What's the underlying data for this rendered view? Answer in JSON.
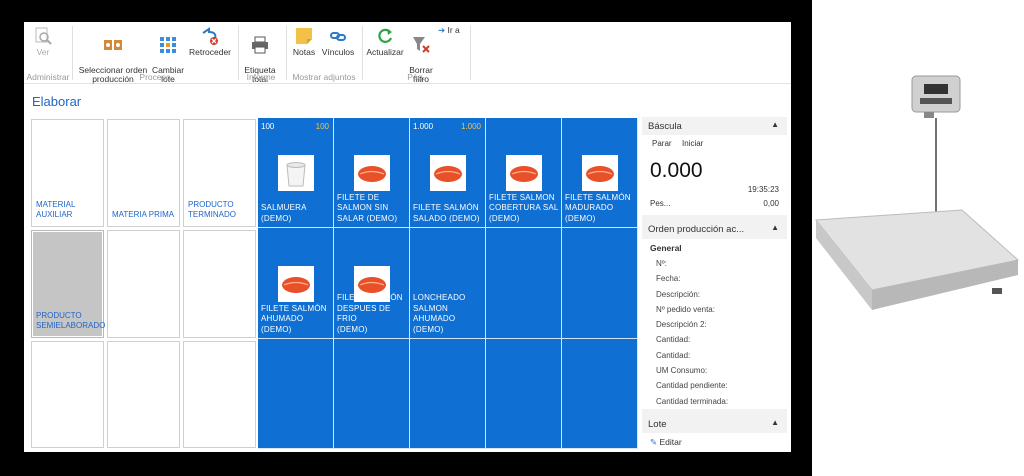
{
  "ribbon": {
    "ver": "Ver",
    "seleccionar": "Seleccionar orden\nproducción",
    "cambiar": "Cambiar\nlote",
    "retroceder": "Retroceder",
    "etiqueta": "Etiqueta\ntotal",
    "notas": "Notas",
    "vinculos": "Vínculos",
    "actualizar": "Actualizar",
    "borrar": "Borrar\nfiltro",
    "ira": "Ir a",
    "groups": {
      "administrar": "Administrar",
      "proceso": "Proceso",
      "informe": "Informe",
      "adjuntos": "Mostrar adjuntos",
      "pag": "Pág."
    }
  },
  "page_title": "Elaborar",
  "categories": {
    "material_auxiliar": "MATERIAL\nAUXILIAR",
    "materia_prima": "MATERIA PRIMA",
    "producto_terminado": "PRODUCTO\nTERMINADO",
    "producto_semielaborado": "PRODUCTO\nSEMIELABORADO"
  },
  "products": {
    "p1": {
      "qty": "100",
      "qty2": "100",
      "label": "SALMUERA\n(DEMO)"
    },
    "p2": {
      "label": "FILETE DE\nSALMON SIN\nSALAR (DEMO)"
    },
    "p3": {
      "qty": "1.000",
      "qty2": "1.000",
      "label": "FILETE SALMÓN\nSALADO (DEMO)"
    },
    "p4": {
      "label": "FILETE SALMON\nCOBERTURA SAL\n(DEMO)"
    },
    "p5": {
      "label": "FILETE SALMÓN\nMADURADO\n(DEMO)"
    },
    "p6": {
      "label": "FILETE SALMÓN\nAHUMADO\n(DEMO)"
    },
    "p7": {
      "label": "FILETE SALMÓN\nDESPUES DE FRIO\n(DEMO)"
    },
    "p8": {
      "label": "LONCHEADO\nSALMON\nAHUMADO\n(DEMO)"
    }
  },
  "bascula": {
    "title": "Báscula",
    "parar": "Parar",
    "iniciar": "Iniciar",
    "reading": "0.000",
    "time": "19:35:23",
    "peso_label": "Pes...",
    "peso_value": "0,00"
  },
  "orden": {
    "title": "Orden producción ac...",
    "general": "General",
    "fields": [
      "Nº:",
      "Fecha:",
      "Descripción:",
      "Nº pedido venta:",
      "Descripción 2:",
      "Cantidad:",
      "Cantidad:",
      "UM Consumo:",
      "Cantidad pendiente:",
      "Cantidad terminada:"
    ]
  },
  "lote": {
    "title": "Lote",
    "editar": "Editar"
  },
  "colors": {
    "tile_blue": "#0f6fd2",
    "accent": "#1e66c8",
    "qty_orange": "#f5c242"
  }
}
